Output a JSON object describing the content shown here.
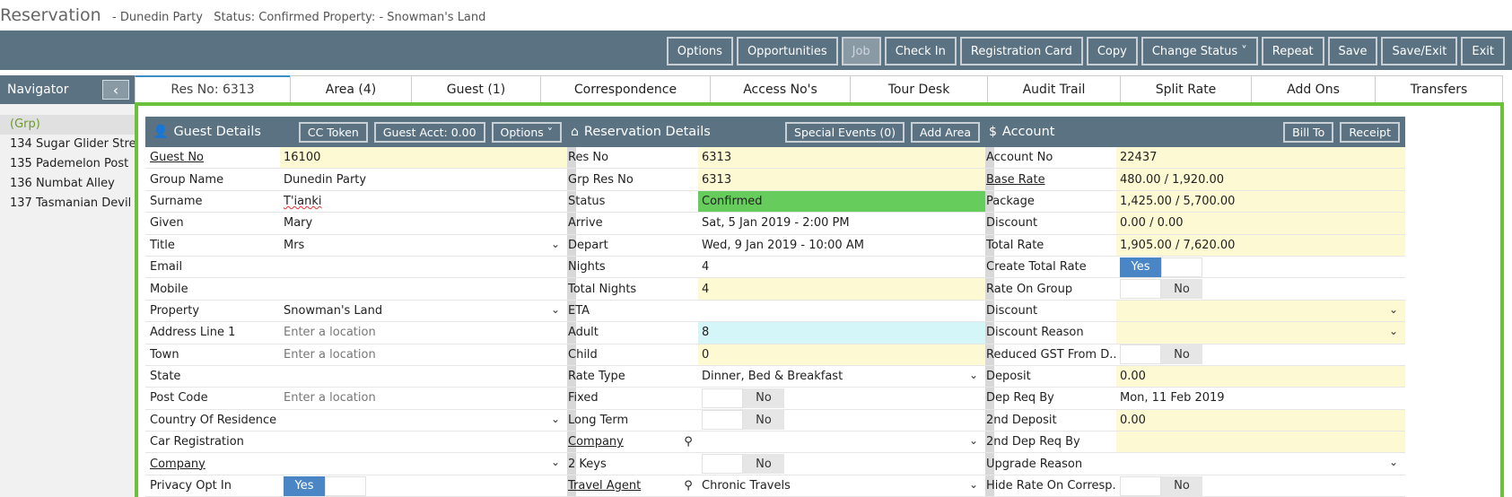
{
  "title": {
    "main": "Reservation",
    "meta": " - Dunedin Party   Status: Confirmed Property: - Snowman's Land"
  },
  "toolbar": {
    "buttons": [
      "Options",
      "Opportunities",
      "Job",
      "Check In",
      "Registration Card",
      "Copy",
      "Change Status ˅",
      "Repeat",
      "Save",
      "Save/Exit",
      "Exit"
    ]
  },
  "navigator": {
    "title": "Navigator",
    "collapse": "‹",
    "items": [
      "(Grp)",
      "134 Sugar Glider Stre",
      "135 Pademelon Post",
      "136 Numbat Alley",
      "137 Tasmanian Devil"
    ]
  },
  "tabs": [
    "Res No: 6313",
    "Area (4)",
    "Guest (1)",
    "Correspondence",
    "Access No's",
    "Tour Desk",
    "Audit Trail",
    "Split Rate",
    "Add Ons",
    "Transfers"
  ],
  "guest": {
    "title": "Guest Details",
    "buttons": [
      "CC Token",
      "Guest Acct: 0.00",
      "Options ˅"
    ],
    "rows": [
      {
        "label": "Guest No",
        "value": "16100"
      },
      {
        "label": "Group Name",
        "value": "Dunedin Party"
      },
      {
        "label": "Surname",
        "value": "T'ianki"
      },
      {
        "label": "Given",
        "value": "Mary"
      },
      {
        "label": "Title",
        "value": "Mrs"
      },
      {
        "label": "Email",
        "value": ""
      },
      {
        "label": "Mobile",
        "value": ""
      },
      {
        "label": "Property",
        "value": "Snowman's Land"
      },
      {
        "label": "Address Line 1",
        "value": "Enter a location"
      },
      {
        "label": "Town",
        "value": "Enter a location"
      },
      {
        "label": "State",
        "value": ""
      },
      {
        "label": "Post Code",
        "value": "Enter a location"
      },
      {
        "label": "Country Of Residence",
        "value": ""
      },
      {
        "label": "Car Registration",
        "value": ""
      },
      {
        "label": "Company",
        "value": ""
      },
      {
        "label": "Privacy Opt In",
        "value": "Yes"
      }
    ]
  },
  "reservation": {
    "title": "Reservation Details",
    "buttons": [
      "Special Events (0)",
      "Add Area"
    ],
    "rows": [
      {
        "label": "Res No",
        "value": "6313"
      },
      {
        "label": "Grp Res No",
        "value": "6313"
      },
      {
        "label": "Status",
        "value": "Confirmed"
      },
      {
        "label": "Arrive",
        "value": "Sat, 5 Jan 2019 - 2:00 PM"
      },
      {
        "label": "Depart",
        "value": "Wed, 9 Jan 2019 - 10:00 AM"
      },
      {
        "label": "Nights",
        "value": "4"
      },
      {
        "label": "Total Nights",
        "value": "4"
      },
      {
        "label": "ETA",
        "value": ""
      },
      {
        "label": "Adult",
        "value": "8"
      },
      {
        "label": "Child",
        "value": "0"
      },
      {
        "label": "Rate Type",
        "value": "Dinner, Bed & Breakfast"
      },
      {
        "label": "Fixed",
        "value": "No"
      },
      {
        "label": "Long Term",
        "value": "No"
      },
      {
        "label": "Company",
        "value": ""
      },
      {
        "label": "2 Keys",
        "value": "No"
      },
      {
        "label": "Travel Agent",
        "value": "Chronic Travels"
      }
    ]
  },
  "account": {
    "title": "Account",
    "buttons": [
      "Bill To",
      "Receipt"
    ],
    "rows": [
      {
        "label": "Account No",
        "value": "22437"
      },
      {
        "label": "Base Rate",
        "value": "480.00 / 1,920.00"
      },
      {
        "label": "Package",
        "value": "1,425.00 / 5,700.00"
      },
      {
        "label": "Discount",
        "value": "0.00 / 0.00"
      },
      {
        "label": "Total Rate",
        "value": "1,905.00 / 7,620.00"
      },
      {
        "label": "Create Total Rate",
        "value": "Yes"
      },
      {
        "label": "Rate On Group",
        "value": "No"
      },
      {
        "label": "Discount",
        "value": ""
      },
      {
        "label": "Discount Reason",
        "value": ""
      },
      {
        "label": "Reduced GST From D...",
        "value": "No"
      },
      {
        "label": "Deposit",
        "value": "0.00"
      },
      {
        "label": "Dep Req By",
        "value": "Mon, 11 Feb 2019"
      },
      {
        "label": "2nd Deposit",
        "value": "0.00"
      },
      {
        "label": "2nd Dep Req By",
        "value": ""
      },
      {
        "label": "Upgrade Reason",
        "value": ""
      },
      {
        "label": "Hide Rate On Corresp...",
        "value": "No"
      }
    ]
  },
  "colors": {
    "toolbar": "#5b7282",
    "frame": "#6cc13a",
    "confirmed": "#66cc5c",
    "yes_toggle": "#4a86c5"
  },
  "icons": {
    "guest": "user-icon",
    "reservation": "home-icon",
    "account": "dollar-icon",
    "search": "search-icon"
  }
}
